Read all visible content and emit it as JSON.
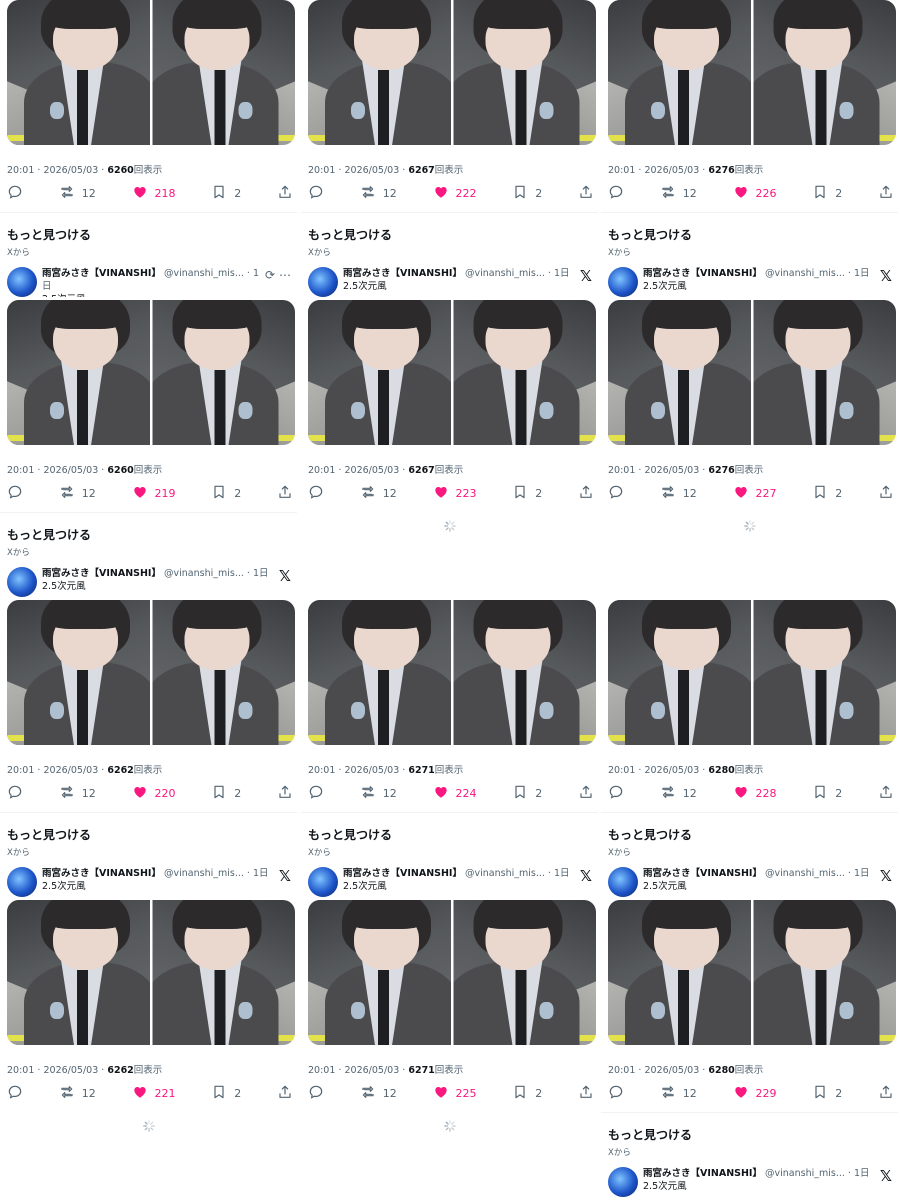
{
  "colors": {
    "like": "#f91880",
    "muted": "#536471",
    "text": "#0f1419",
    "accent_x": "#0f1419"
  },
  "tweet": {
    "time": "20:01",
    "sep": "·",
    "date": "2026/05/03",
    "views_suffix": "回表示",
    "retweets": "12",
    "bookmarks": "2"
  },
  "more_section": {
    "title": "もっと見つける",
    "sub": "Xから"
  },
  "user": {
    "name": "雨宮みさき【VINANSHI】",
    "handle": "@vinanshi_mis...",
    "age": "1日",
    "bio": "2.5次元風"
  },
  "panels": [
    {
      "views": "6260",
      "likes": "218"
    },
    {
      "views": "6267",
      "likes": "222"
    },
    {
      "views": "6276",
      "likes": "226"
    },
    {
      "views": "6260",
      "likes": "219"
    },
    {
      "views": "6267",
      "likes": "223"
    },
    {
      "views": "6276",
      "likes": "227"
    },
    {
      "views": "6262",
      "likes": "220"
    },
    {
      "views": "6271",
      "likes": "224"
    },
    {
      "views": "6280",
      "likes": "228"
    },
    {
      "views": "6262",
      "likes": "221"
    },
    {
      "views": "6271",
      "likes": "225"
    },
    {
      "views": "6280",
      "likes": "229"
    }
  ],
  "icons": [
    "reply-icon",
    "retweet-icon",
    "heart-icon",
    "bookmark-icon",
    "share-icon",
    "x-logo-icon",
    "grok-icon",
    "more-icon",
    "loading-spinner-icon"
  ]
}
